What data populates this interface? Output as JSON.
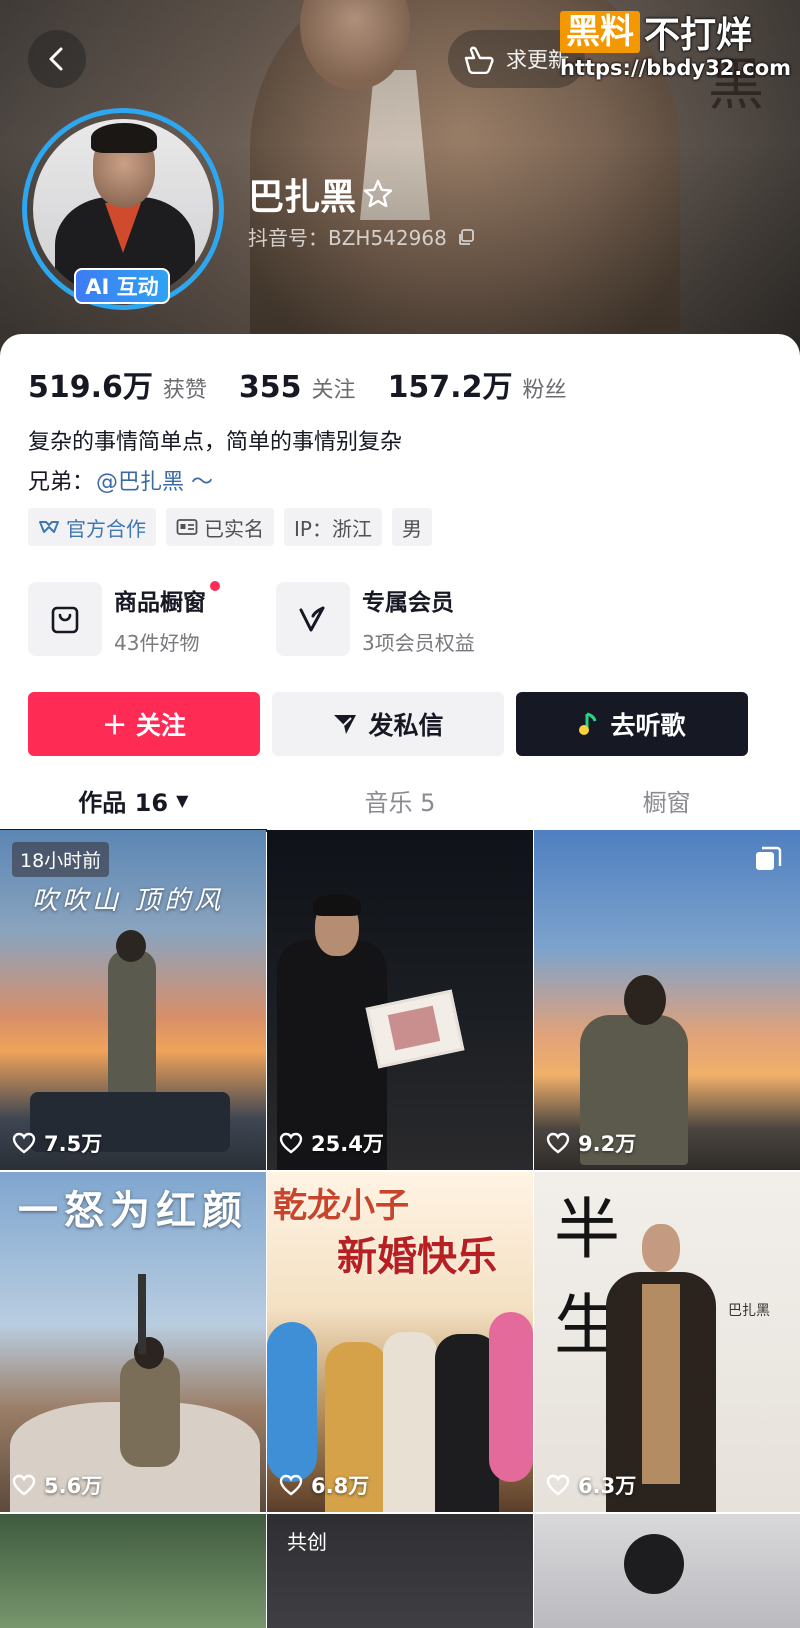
{
  "header": {
    "update_label": "求更新",
    "watermark": {
      "box_text": "黑料",
      "rest_text": "不打烊",
      "url": "https://bbdy32.com"
    },
    "ai_badge": "AI 互动",
    "name": "巴扎黑",
    "douyin_id": "抖音号：BZH542968"
  },
  "stats": [
    {
      "value": "519.6万",
      "label": "获赞"
    },
    {
      "value": "355",
      "label": "关注"
    },
    {
      "value": "157.2万",
      "label": "粉丝"
    }
  ],
  "bio": {
    "line1": "复杂的事情简单点，简单的事情别复杂",
    "brother_prefix": "兄弟：",
    "brother_link": "@巴扎黑 ～"
  },
  "tags": [
    "官方合作",
    "已实名",
    "IP：浙江",
    "男"
  ],
  "features": [
    {
      "title": "商品橱窗",
      "subtitle": "43件好物"
    },
    {
      "title": "专属会员",
      "subtitle": "3项会员权益"
    }
  ],
  "actions": {
    "follow": "＋ 关注",
    "message": "发私信",
    "song": "去听歌"
  },
  "tabs": [
    {
      "label": "作品 16"
    },
    {
      "label": "音乐 5"
    },
    {
      "label": "橱窗"
    }
  ],
  "videos": [
    {
      "likes": "7.5万",
      "badge": "18小时前",
      "overlay": "吹吹山 顶的风"
    },
    {
      "likes": "25.4万"
    },
    {
      "likes": "9.2万"
    },
    {
      "likes": "5.6万",
      "overlay": "一怒为红颜"
    },
    {
      "likes": "6.8万",
      "overlay_top": "乾龙小子",
      "overlay_main": "新婚快乐"
    },
    {
      "likes": "6.3万",
      "overlay_main": "半 生",
      "overlay_small": "巴扎黑"
    },
    {
      "badge": "共创"
    }
  ],
  "colors": {
    "accent": "#fe2c55",
    "dark": "#161823",
    "link": "#3b6aa5",
    "ring": "#2ea6f0",
    "watermark": "#f39800"
  }
}
